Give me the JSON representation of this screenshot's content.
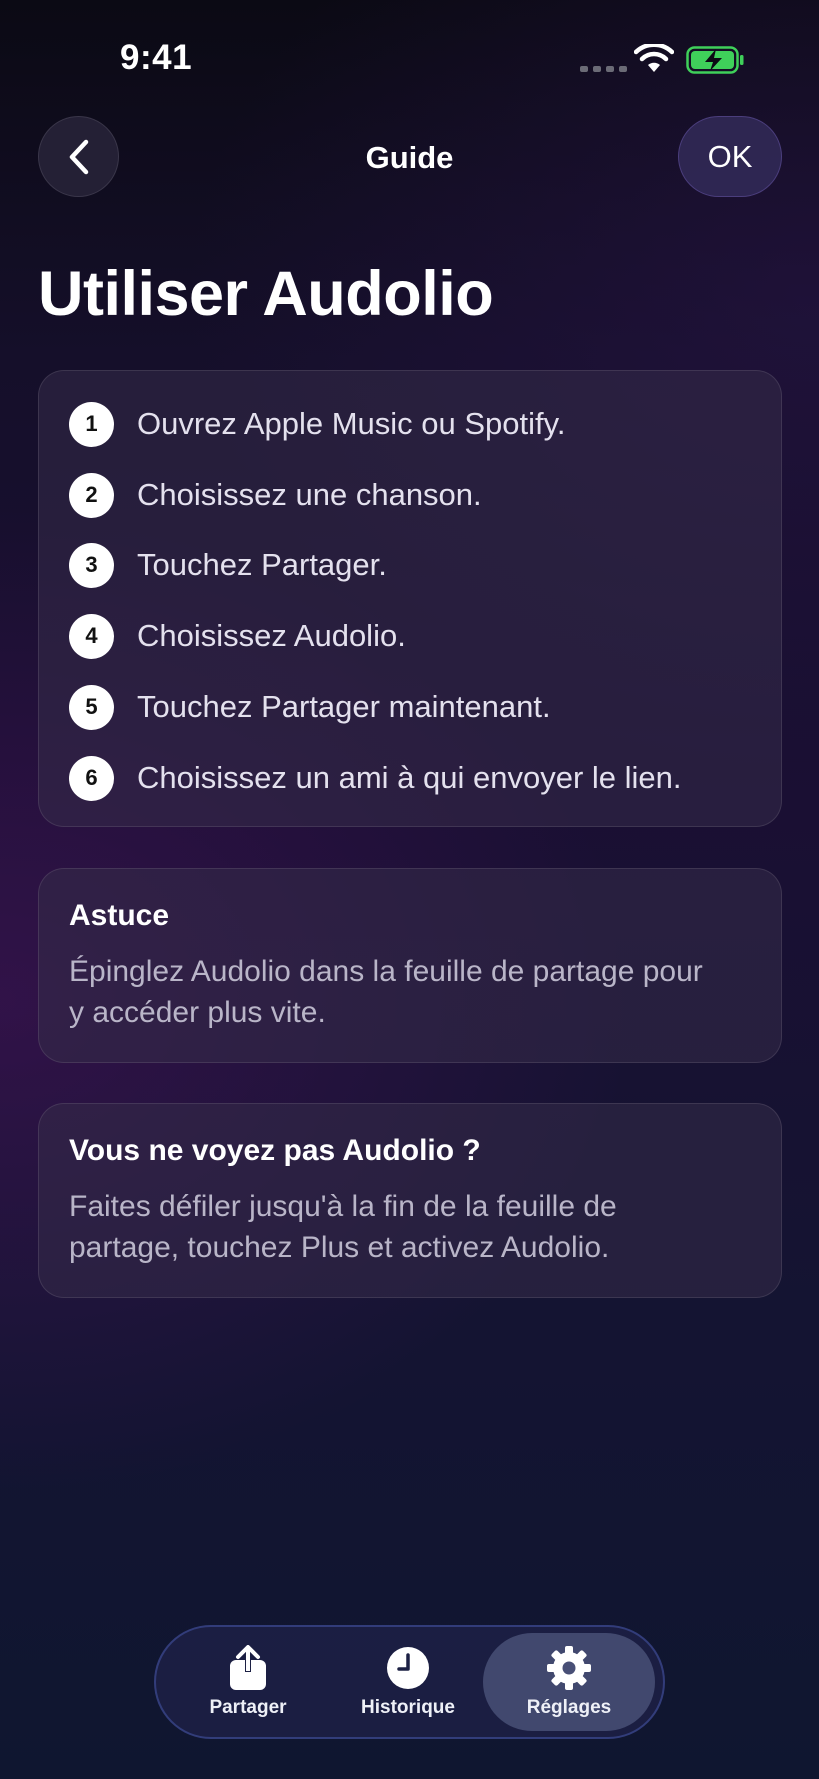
{
  "status_bar": {
    "time": "9:41"
  },
  "nav": {
    "title": "Guide",
    "ok_label": "OK"
  },
  "page": {
    "title": "Utiliser Audolio"
  },
  "steps": [
    {
      "number": "1",
      "text": "Ouvrez Apple Music ou Spotify."
    },
    {
      "number": "2",
      "text": "Choisissez une chanson."
    },
    {
      "number": "3",
      "text": "Touchez Partager."
    },
    {
      "number": "4",
      "text": "Choisissez Audolio."
    },
    {
      "number": "5",
      "text": "Touchez Partager maintenant."
    },
    {
      "number": "6",
      "text": "Choisissez un ami à qui envoyer le lien."
    }
  ],
  "tip": {
    "title": "Astuce",
    "body_line1": "Épinglez Audolio dans la feuille de partage pour",
    "body_line2": "y accéder plus vite."
  },
  "help": {
    "title": "Vous ne voyez pas Audolio ?",
    "body_line1": "Faites défiler jusqu'à la fin de la feuille de",
    "body_line2": "partage, touchez Plus et activez Audolio."
  },
  "tab_bar": {
    "tabs": [
      {
        "label": "Partager",
        "icon": "share-icon",
        "active": false
      },
      {
        "label": "Historique",
        "icon": "clock-icon",
        "active": false
      },
      {
        "label": "Réglages",
        "icon": "gear-icon",
        "active": true
      }
    ]
  },
  "colors": {
    "battery_fill": "#3fd05a",
    "card_background": "#342c48",
    "tab_bar_border": "#5064be"
  }
}
